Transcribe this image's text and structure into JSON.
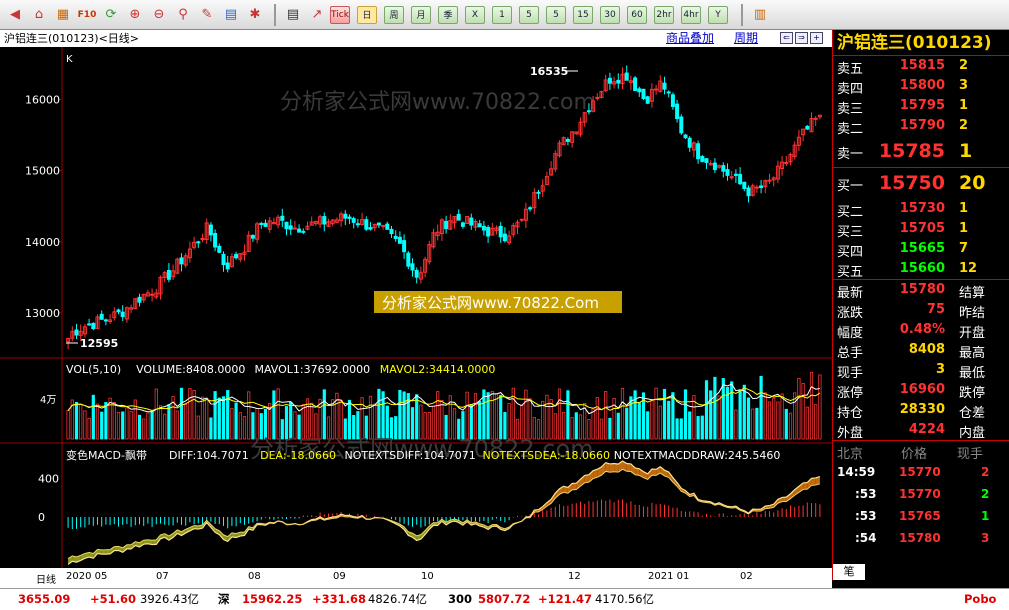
{
  "toolbar": {
    "text_buttons": [
      "Tick",
      "日",
      "周",
      "月",
      "季",
      "X",
      "1",
      "5",
      "5",
      "15",
      "30",
      "60",
      "2hr",
      "4hr",
      "Y"
    ]
  },
  "chart_header": {
    "title": "沪铝连三(010123)<日线>",
    "overlay_link": "商品叠加",
    "period_link": "周期",
    "nav_buttons": [
      "⇐",
      "⇒",
      "+",
      "−"
    ]
  },
  "watermark": {
    "top": "分析家公式网www.70822.com",
    "label": "分析家公式网www.70822.Com",
    "macd": "分析家公式网www.70822.com"
  },
  "colors": {
    "up": "#ff3232",
    "down": "#00ffff",
    "grid": "#a00000",
    "white": "#ffffff",
    "yellow": "#ffff00",
    "green": "#00ff00"
  },
  "chart_data": [
    {
      "type": "candlestick",
      "panel_label": "K",
      "yticks": [
        13000,
        14000,
        15000,
        16000
      ],
      "ylim": [
        12450,
        16600
      ],
      "high_label": "16535",
      "low_label": "12595",
      "x_labels": [
        "2020 05",
        "07",
        "08",
        "09",
        "10",
        "12",
        "2021 01",
        "02"
      ],
      "closes_approx": [
        12700,
        12820,
        12900,
        13000,
        13200,
        13350,
        13600,
        13900,
        14200,
        13650,
        13900,
        14250,
        14300,
        14200,
        14250,
        14300,
        14350,
        14250,
        14150,
        13950,
        13500,
        14150,
        14350,
        14250,
        14150,
        14100,
        14300,
        14800,
        15300,
        15600,
        16000,
        16300,
        16350,
        16000,
        16250,
        15600,
        15250,
        15100,
        14900,
        14700,
        14800,
        15100,
        15500,
        15780
      ]
    },
    {
      "type": "bar",
      "panel_label": "VOL(5,10)",
      "readouts": [
        {
          "label": "VOL(5,10)",
          "color": "white"
        },
        {
          "label": "VOLUME:8408.0000",
          "color": "white"
        },
        {
          "label": "MAVOL1:37692.0000",
          "color": "white"
        },
        {
          "label": "MAVOL2:34414.0000",
          "color": "yellow"
        }
      ],
      "yticks": [
        "4万"
      ]
    },
    {
      "type": "bar",
      "panel_label": "变色MACD-飘带",
      "readouts": [
        {
          "label": "变色MACD-飘带",
          "color": "white"
        },
        {
          "label": "DIFF:104.7071",
          "color": "white"
        },
        {
          "label": "DEA:-18.0660",
          "color": "yellow"
        },
        {
          "label": "NOTEXTSDIFF:104.7071",
          "color": "white"
        },
        {
          "label": "NOTEXTSDEA:-18.0660",
          "color": "yellow"
        },
        {
          "label": "NOTEXTMACDDRAW:245.5460",
          "color": "white"
        }
      ],
      "yticks": [
        0,
        400
      ],
      "ylim": [
        -520,
        520
      ]
    }
  ],
  "quote": {
    "title": "沪铝连三(010123)",
    "sell": [
      {
        "label": "卖五",
        "price": "15815",
        "vol": "2",
        "color": "#ff3232"
      },
      {
        "label": "卖四",
        "price": "15800",
        "vol": "3",
        "color": "#ff3232"
      },
      {
        "label": "卖三",
        "price": "15795",
        "vol": "1",
        "color": "#ff3232"
      },
      {
        "label": "卖二",
        "price": "15790",
        "vol": "2",
        "color": "#ff3232"
      },
      {
        "label": "卖一",
        "price": "15785",
        "vol": "1",
        "color": "#ff3232"
      }
    ],
    "buy": [
      {
        "label": "买一",
        "price": "15750",
        "vol": "20",
        "color": "#ff3232"
      },
      {
        "label": "买二",
        "price": "15730",
        "vol": "1",
        "color": "#ff3232"
      },
      {
        "label": "买三",
        "price": "15705",
        "vol": "1",
        "color": "#ff3232"
      },
      {
        "label": "买四",
        "price": "15665",
        "vol": "7",
        "color": "#00ff00"
      },
      {
        "label": "买五",
        "price": "15660",
        "vol": "12",
        "color": "#00ff00"
      }
    ],
    "stats": [
      {
        "label": "最新",
        "value": "15780",
        "color": "#ff3232",
        "label2": "结算"
      },
      {
        "label": "涨跌",
        "value": "75",
        "color": "#ff3232",
        "label2": "昨结"
      },
      {
        "label": "幅度",
        "value": "0.48%",
        "color": "#ff3232",
        "label2": "开盘"
      },
      {
        "label": "总手",
        "value": "8408",
        "color": "#ffd700",
        "label2": "最高"
      },
      {
        "label": "现手",
        "value": "3",
        "color": "#ffd700",
        "label2": "最低"
      },
      {
        "label": "涨停",
        "value": "16960",
        "color": "#ff3232",
        "label2": "跌停"
      },
      {
        "label": "持仓",
        "value": "28330",
        "color": "#ffd700",
        "label2": "仓差"
      },
      {
        "label": "外盘",
        "value": "4224",
        "color": "#ff3232",
        "label2": "内盘"
      }
    ],
    "tick_header": {
      "place": "北京",
      "price": "价格",
      "vol": "现手"
    },
    "ticks": [
      {
        "time": "14:59",
        "price": "15770",
        "vol": "2",
        "vol_color": "#ff3232"
      },
      {
        "time": ":53",
        "price": "15770",
        "vol": "2",
        "vol_color": "#00ff00"
      },
      {
        "time": ":53",
        "price": "15765",
        "vol": "1",
        "vol_color": "#00ff00"
      },
      {
        "time": ":54",
        "price": "15780",
        "vol": "3",
        "vol_color": "#ff3232"
      }
    ],
    "tab": "笔"
  },
  "date_axis": {
    "period": "日线",
    "labels": [
      "2020 05",
      "07",
      "08",
      "09",
      "10",
      "12",
      "2021 01",
      "02"
    ]
  },
  "status_bar": {
    "idx1_value": "3655.09",
    "idx1_change": "+51.60",
    "idx1_amount": "3926.43亿",
    "idx2_name": "深",
    "idx2_value": "15962.25",
    "idx2_change": "+331.68",
    "idx2_amount": "4826.74亿",
    "idx3_name": "300",
    "idx3_value": "5807.72",
    "idx3_change": "+121.47",
    "idx3_amount": "4170.56亿",
    "brand": "Pobo"
  }
}
